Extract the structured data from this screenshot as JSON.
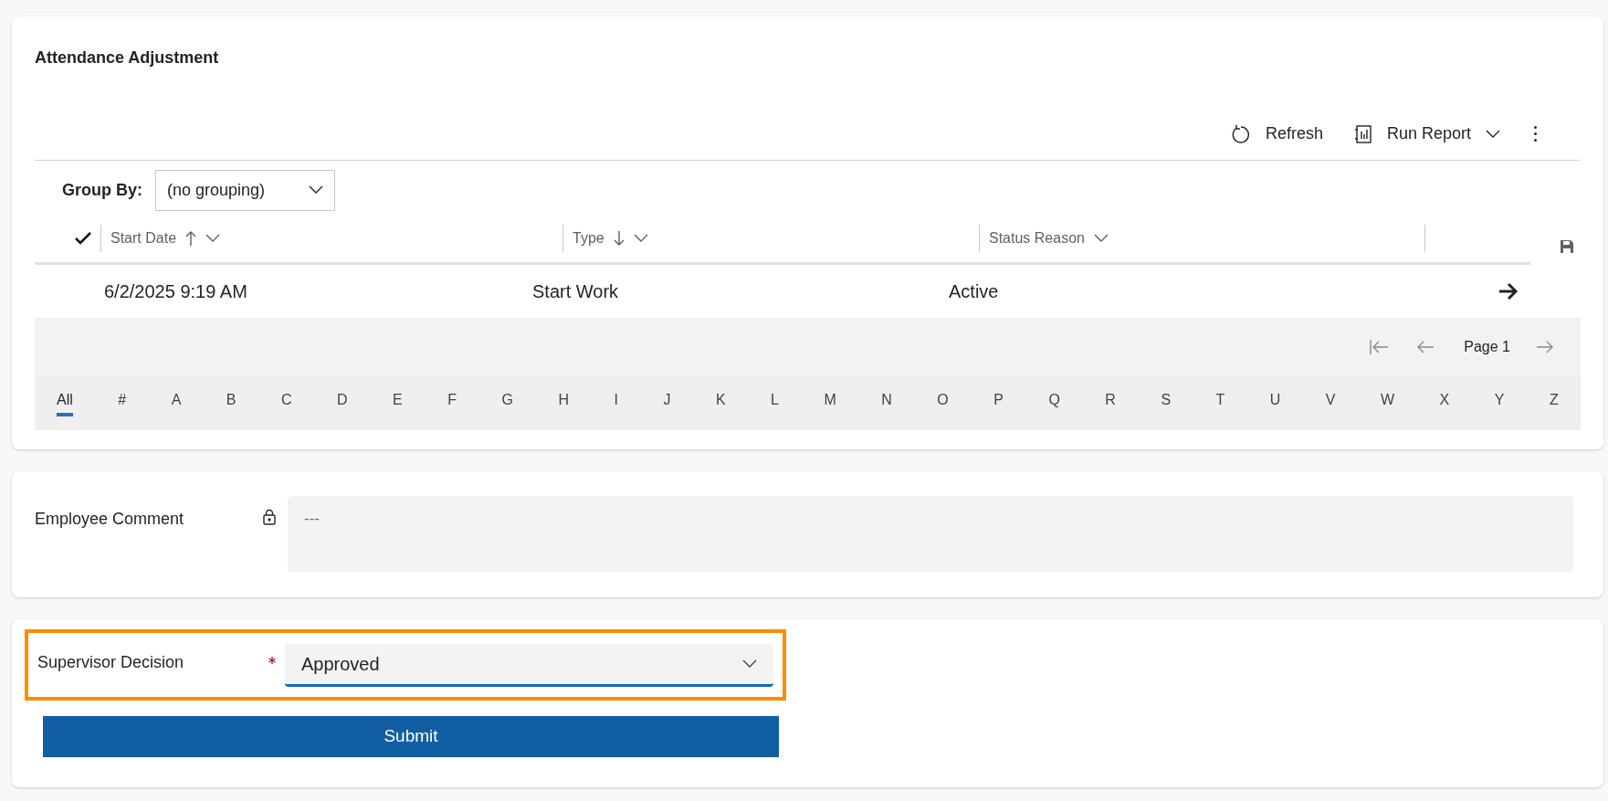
{
  "grid_card": {
    "title": "Attendance Adjustment",
    "toolbar": [
      {
        "kind": "refresh",
        "label": "Refresh"
      },
      {
        "kind": "report",
        "label": "Run Report"
      },
      {
        "kind": "more"
      }
    ],
    "group_by": {
      "label": "Group By:",
      "value": "(no grouping)"
    },
    "columns": [
      {
        "label": "Start Date",
        "sort_up": true,
        "sort_down": false
      },
      {
        "label": "Type",
        "sort_up": false,
        "sort_down": true
      },
      {
        "label": "Status Reason",
        "sort_up": false,
        "sort_down": false
      }
    ],
    "rows": [
      {
        "cells": [
          "6/2/2025 9:19 AM",
          "Start Work",
          "Active"
        ]
      }
    ],
    "pager": {
      "page": "Page 1"
    },
    "letters": [
      {
        "label": "All",
        "selected": true
      },
      {
        "label": "#",
        "selected": false
      },
      {
        "label": "A",
        "selected": false
      },
      {
        "label": "B",
        "selected": false
      },
      {
        "label": "C",
        "selected": false
      },
      {
        "label": "D",
        "selected": false
      },
      {
        "label": "E",
        "selected": false
      },
      {
        "label": "F",
        "selected": false
      },
      {
        "label": "G",
        "selected": false
      },
      {
        "label": "H",
        "selected": false
      },
      {
        "label": "I",
        "selected": false
      },
      {
        "label": "J",
        "selected": false
      },
      {
        "label": "K",
        "selected": false
      },
      {
        "label": "L",
        "selected": false
      },
      {
        "label": "M",
        "selected": false
      },
      {
        "label": "N",
        "selected": false
      },
      {
        "label": "O",
        "selected": false
      },
      {
        "label": "P",
        "selected": false
      },
      {
        "label": "Q",
        "selected": false
      },
      {
        "label": "R",
        "selected": false
      },
      {
        "label": "S",
        "selected": false
      },
      {
        "label": "T",
        "selected": false
      },
      {
        "label": "U",
        "selected": false
      },
      {
        "label": "V",
        "selected": false
      },
      {
        "label": "W",
        "selected": false
      },
      {
        "label": "X",
        "selected": false
      },
      {
        "label": "Y",
        "selected": false
      },
      {
        "label": "Z",
        "selected": false
      }
    ]
  },
  "comment_card": {
    "label": "Employee Comment",
    "locked": true,
    "placeholder": "---"
  },
  "decision_card": {
    "label": "Supervisor Decision",
    "required": true,
    "value": "Approved",
    "highlighted": true,
    "submit": "Submit"
  }
}
